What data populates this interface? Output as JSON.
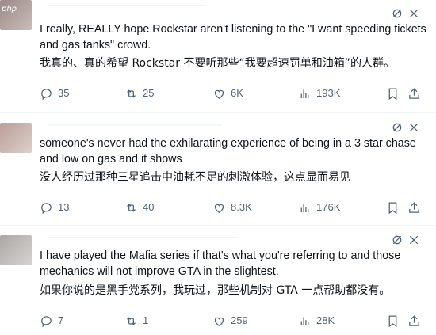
{
  "watermark": "php",
  "tweets": [
    {
      "text_en": "I really, REALLY hope Rockstar aren't listening to the \"I want speeding tickets and gas tanks\" crowd.",
      "text_zh": "我真的、真的希望 Rockstar 不要听那些“我要超速罚单和油箱”的人群。",
      "replies": "35",
      "retweets": "25",
      "likes": "6K",
      "views": "193K"
    },
    {
      "text_en": "someone's never had the exhilarating experience of being in a 3 star chase and low on gas and it shows",
      "text_zh": "没人经历过那种三星追击中油耗不足的刺激体验，这点显而易见",
      "replies": "13",
      "retweets": "40",
      "likes": "8.3K",
      "views": "176K"
    },
    {
      "text_en": "I have played the Mafia series if that's what you're referring to and those mechanics will not improve GTA in the slightest.",
      "text_zh": "如果你说的是黑手党系列，我玩过，那些机制对 GTA 一点帮助都没有。",
      "replies": "7",
      "retweets": "1",
      "likes": "259",
      "views": "28K"
    }
  ],
  "colors": {
    "text": "#0f1419",
    "muted": "#536471",
    "divider": "#eff3f4"
  },
  "icons": [
    "grok-icon",
    "reply-icon",
    "retweet-icon",
    "like-icon",
    "views-icon",
    "bookmark-icon",
    "share-icon"
  ]
}
